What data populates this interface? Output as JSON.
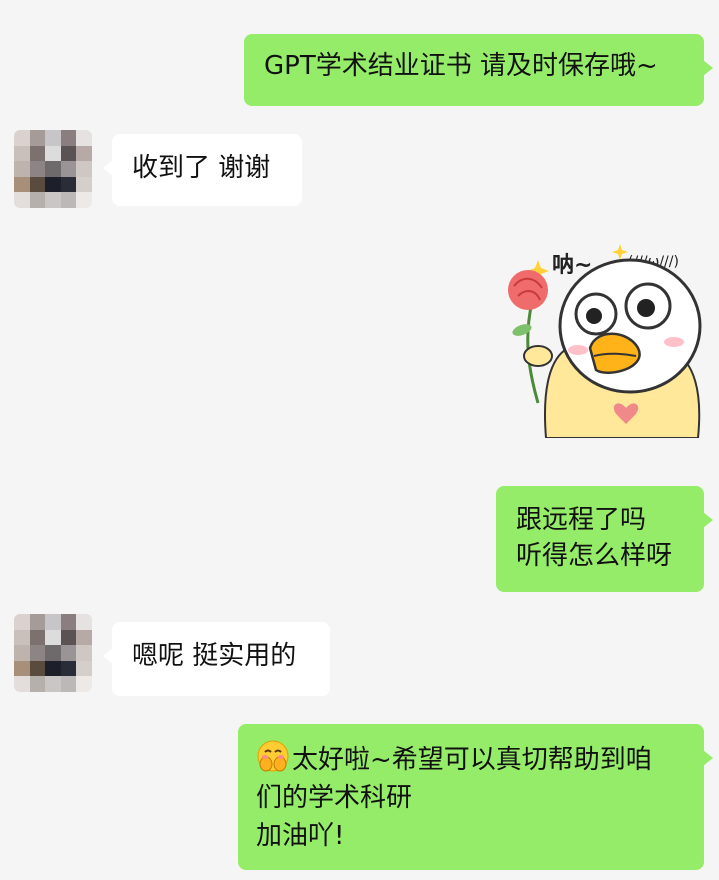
{
  "conversation": {
    "messages": [
      {
        "side": "sent",
        "lines": [
          "GPT学术结业证书 请及时保存哦~"
        ]
      },
      {
        "side": "received",
        "lines": [
          "收到了 谢谢"
        ]
      },
      {
        "side": "sent",
        "type": "sticker",
        "sticker_text": "呐~",
        "sticker_text2": "(///ω///)"
      },
      {
        "side": "sent",
        "lines": [
          "跟远程了吗",
          "听得怎么样呀"
        ]
      },
      {
        "side": "received",
        "lines": [
          "嗯呢 挺实用的"
        ]
      },
      {
        "side": "sent",
        "emoji": "smiling-hands-over-mouth-emoji",
        "lines": [
          "太好啦~希望可以真切帮助到咱",
          "们的学术科研",
          "加油吖!"
        ]
      }
    ]
  },
  "colors": {
    "background": "#f5f5f5",
    "sent_bubble": "#95ec69",
    "received_bubble": "#ffffff"
  }
}
